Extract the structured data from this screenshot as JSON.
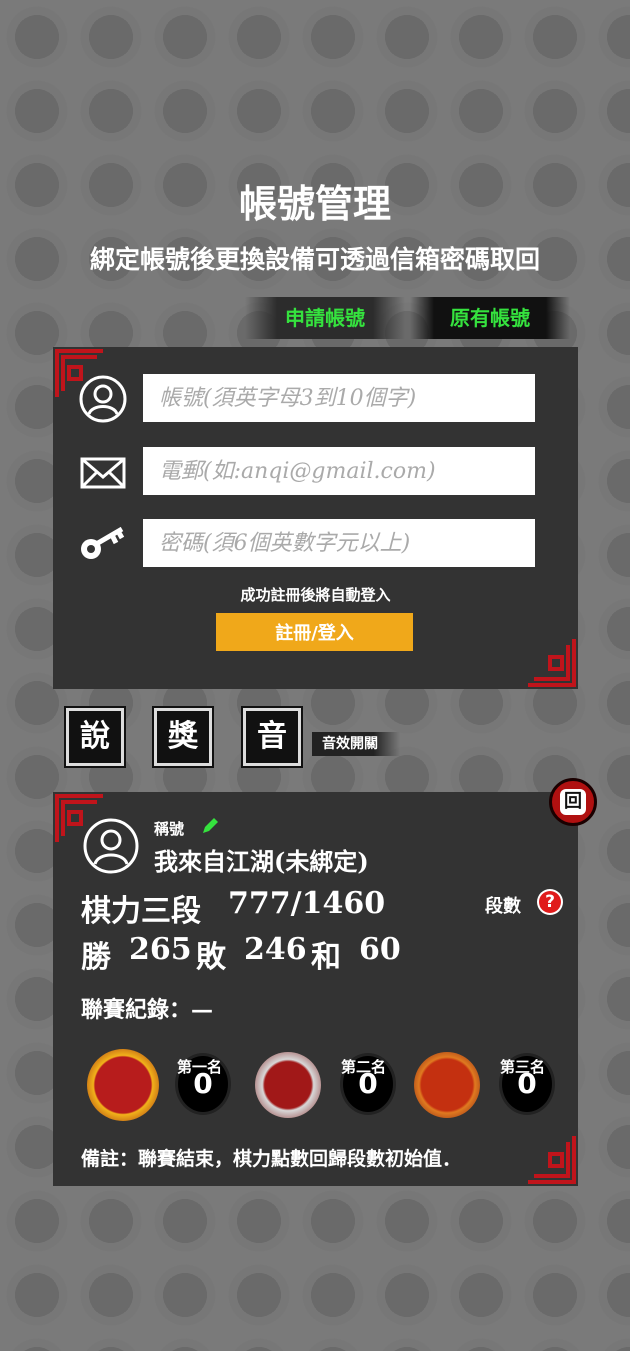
{
  "header": {
    "title": "帳號管理",
    "subtitle": "綁定帳號後更換設備可透過信箱密碼取回"
  },
  "tabs": {
    "register": "申請帳號",
    "existing": "原有帳號"
  },
  "form": {
    "account_placeholder": "帳號(須英字母3到10個字)",
    "email_placeholder": "電郵(如:anqi@gmail.com)",
    "password_placeholder": "密碼(須6個英數字元以上)",
    "auto_login_note": "成功註冊後將自動登入",
    "submit_label": "註冊/登入"
  },
  "toolbar": {
    "buttons": [
      "說",
      "獎",
      "音"
    ],
    "sound_label": "音效開關"
  },
  "profile": {
    "back_label": "回",
    "nickname_label": "稱號",
    "nickname": "我來自江湖(未綁定)",
    "rank_text": "棋力三段",
    "rank_points": "777/1460",
    "dan_label": "段數",
    "help_icon": "?",
    "record_win_label": "勝",
    "record_win": "265",
    "record_loss_label": "敗",
    "record_loss": "246",
    "record_draw_label": "和",
    "record_draw": "60",
    "league_record": "聯賽紀錄：—",
    "ranks": [
      {
        "label": "第一名",
        "count": "0",
        "color": "#d8a010"
      },
      {
        "label": "第二名",
        "count": "0",
        "color": "#c9c9c9"
      },
      {
        "label": "第三名",
        "count": "0",
        "color": "#d2601c"
      }
    ],
    "footnote": "備註：聯賽結束，棋力點數回歸段數初始值．"
  },
  "colors": {
    "accent_green": "#35e23e",
    "button_orange": "#f0a81a",
    "ornament_red": "#c0141b"
  }
}
